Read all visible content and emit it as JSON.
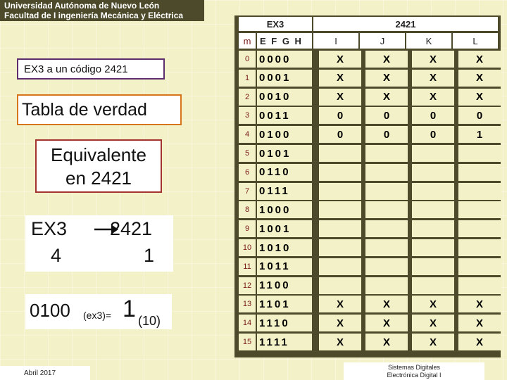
{
  "header": {
    "line1": "Universidad Autónoma de Nuevo León",
    "line2": "Facultad de I ingeniería Mecánica y Eléctrica"
  },
  "title_box": "EX3 a  un código 2421",
  "tabla_box": "Tabla de verdad",
  "equiv_box": {
    "line1": "Equivalente",
    "line2": "en 2421"
  },
  "conversion": {
    "from_code": "EX3",
    "to_code": "2421",
    "from_value": "4",
    "to_value": "1"
  },
  "equation": {
    "number": "0100",
    "sub1": "(ex3)=",
    "result": "1",
    "sub2": "(10)"
  },
  "table": {
    "group_ex3": "EX3",
    "group_2421": "2421",
    "col_m": "m",
    "col_inputs": "E F G H",
    "col_outputs": [
      "I",
      "J",
      "K",
      "L"
    ],
    "rows": [
      {
        "m": "0",
        "code": "0000",
        "out": [
          "X",
          "X",
          "X",
          "X"
        ]
      },
      {
        "m": "1",
        "code": "0001",
        "out": [
          "X",
          "X",
          "X",
          "X"
        ]
      },
      {
        "m": "2",
        "code": "0010",
        "out": [
          "X",
          "X",
          "X",
          "X"
        ]
      },
      {
        "m": "3",
        "code": "0011",
        "out": [
          "0",
          "0",
          "0",
          "0"
        ]
      },
      {
        "m": "4",
        "code": "0100",
        "out": [
          "0",
          "0",
          "0",
          "1"
        ]
      },
      {
        "m": "5",
        "code": "0101",
        "out": [
          "",
          "",
          "",
          ""
        ]
      },
      {
        "m": "6",
        "code": "0110",
        "out": [
          "",
          "",
          "",
          ""
        ]
      },
      {
        "m": "7",
        "code": "0111",
        "out": [
          "",
          "",
          "",
          ""
        ]
      },
      {
        "m": "8",
        "code": "1000",
        "out": [
          "",
          "",
          "",
          ""
        ]
      },
      {
        "m": "9",
        "code": "1001",
        "out": [
          "",
          "",
          "",
          ""
        ]
      },
      {
        "m": "10",
        "code": "1010",
        "out": [
          "",
          "",
          "",
          ""
        ]
      },
      {
        "m": "11",
        "code": "1011",
        "out": [
          "",
          "",
          "",
          ""
        ]
      },
      {
        "m": "12",
        "code": "1100",
        "out": [
          "",
          "",
          "",
          ""
        ]
      },
      {
        "m": "13",
        "code": "1101",
        "out": [
          "X",
          "X",
          "X",
          "X"
        ]
      },
      {
        "m": "14",
        "code": "1110",
        "out": [
          "X",
          "X",
          "X",
          "X"
        ]
      },
      {
        "m": "15",
        "code": "1111",
        "out": [
          "X",
          "X",
          "X",
          "X"
        ]
      }
    ]
  },
  "footer": {
    "date": "Abril 2017",
    "course_line1": "Sistemas Digitales",
    "course_line2": "Electrónica Digital I"
  },
  "colors": {
    "panel": "#4c4a2a",
    "background": "#f3f1c8",
    "title_border": "#5e2d6e",
    "tabla_border": "#d6751c",
    "equiv_border": "#a4322e",
    "index_text": "#7a1a1a"
  }
}
